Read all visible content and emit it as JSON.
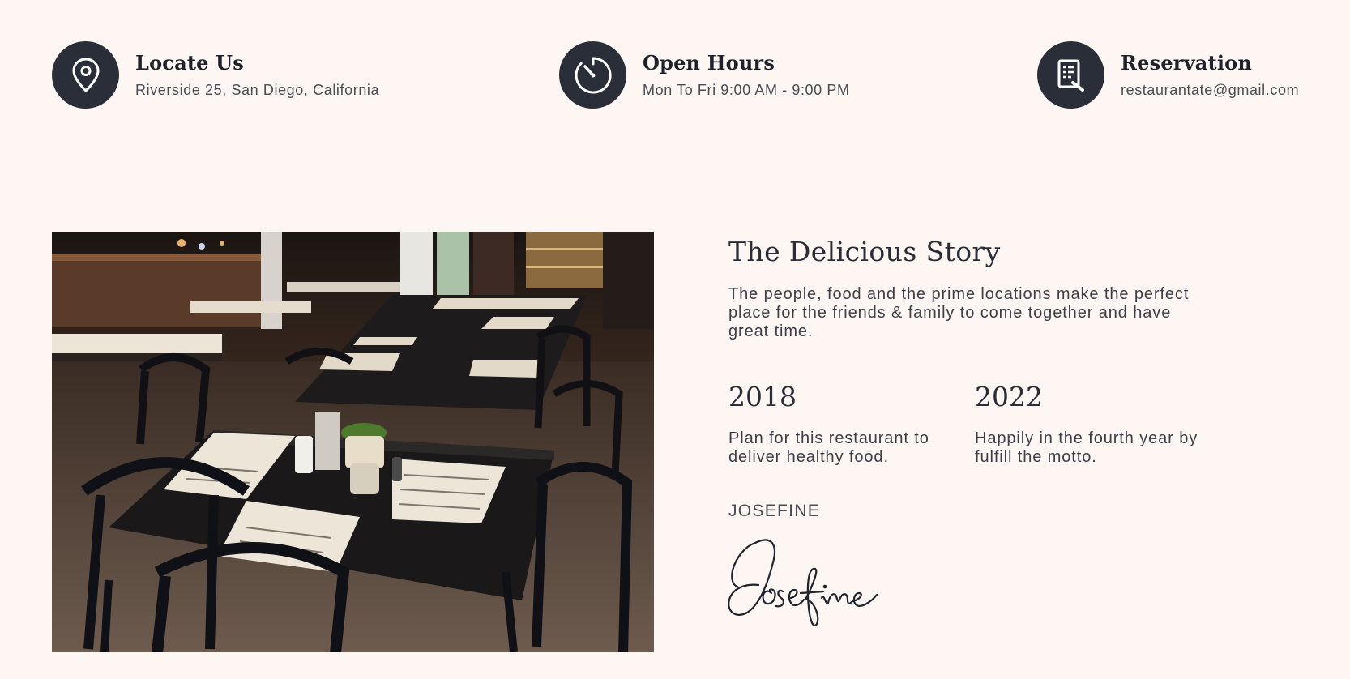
{
  "info": [
    {
      "icon": "map-pin-icon",
      "title": "Locate Us",
      "subtitle": "Riverside 25, San Diego, California"
    },
    {
      "icon": "clock-icon",
      "title": "Open Hours",
      "subtitle": "Mon To Fri 9:00 AM - 9:00 PM"
    },
    {
      "icon": "reservation-list-icon",
      "title": "Reservation",
      "subtitle": "restaurantate@gmail.com"
    }
  ],
  "story": {
    "title": "The Delicious Story",
    "text": "The people, food and the prime locations make the perfect place for the friends & family to come together and have great time.",
    "stats": [
      {
        "year": "2018",
        "text": "Plan for this restaurant to deliver healthy food."
      },
      {
        "year": "2022",
        "text": "Happily in the fourth year by fulfill the motto."
      }
    ],
    "author": "JOSEFINE",
    "signature": "Josefine"
  },
  "colors": {
    "background": "#fdf6f3",
    "icon_circle": "#2a2e38",
    "heading": "#2a2d35",
    "body_text": "#3c3f47"
  }
}
